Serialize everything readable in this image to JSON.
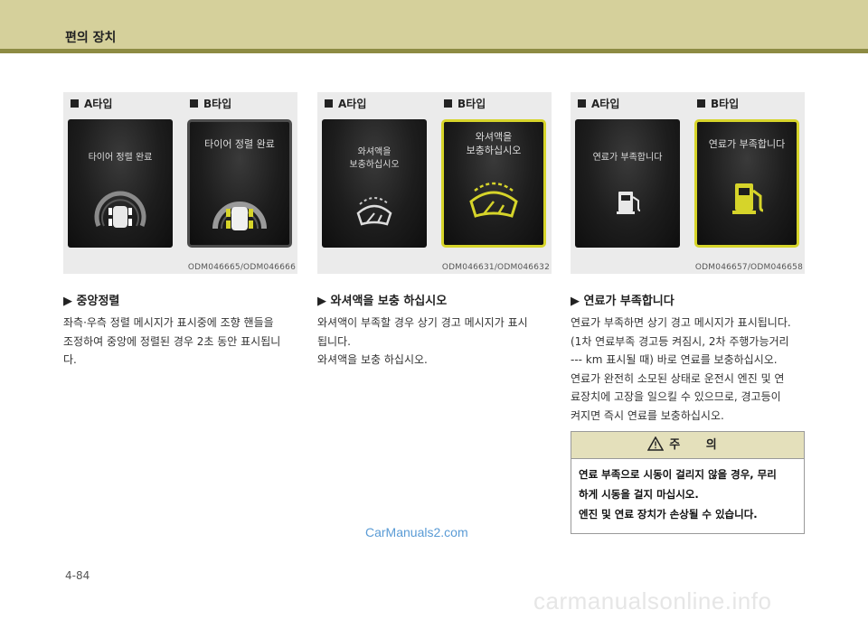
{
  "header": {
    "title": "편의 장치"
  },
  "columns": [
    {
      "panels": [
        {
          "type_label": "A타입",
          "screen_text": [
            "타이어 정렬 완료"
          ]
        },
        {
          "type_label": "B타입",
          "screen_text": [
            "타이어 정렬 완료"
          ]
        }
      ],
      "figure_code": "ODM046665/ODM046666",
      "section_title": "▶ 중앙정렬",
      "body_lines": [
        "좌측·우측 정렬 메시지가 표시중에 조향 핸들을",
        "조정하여 중앙에 정렬된 경우 2초 동안 표시됩니",
        "다."
      ]
    },
    {
      "panels": [
        {
          "type_label": "A타입",
          "screen_text": [
            "와셔액을",
            "보충하십시오"
          ]
        },
        {
          "type_label": "B타입",
          "screen_text": [
            "와셔액을",
            "보충하십시오"
          ]
        }
      ],
      "figure_code": "ODM046631/ODM046632",
      "section_title": "▶ 와셔액을 보충 하십시오",
      "body_lines": [
        "와셔액이 부족할 경우 상기 경고 메시지가 표시",
        "됩니다.",
        "와셔액을 보충 하십시오."
      ]
    },
    {
      "panels": [
        {
          "type_label": "A타입",
          "screen_text": [
            "연료가 부족합니다"
          ]
        },
        {
          "type_label": "B타입",
          "screen_text": [
            "연료가 부족합니다"
          ]
        }
      ],
      "figure_code": "ODM046657/ODM046658",
      "section_title": "▶ 연료가 부족합니다",
      "body_lines": [
        "연료가 부족하면 상기 경고 메시지가 표시됩니다.",
        "(1차 연료부족 경고등 켜짐시, 2차 주행가능거리",
        "--- km 표시될 때) 바로 연료를 보충하십시오.",
        "연료가 완전히 소모된 상태로 운전시 엔진 및 연",
        "료장치에 고장을 일으킬 수 있으므로, 경고등이",
        "켜지면 즉시 연료를 보충하십시오."
      ]
    }
  ],
  "caution": {
    "title": "주 의",
    "lines": [
      "연료 부족으로 시동이  걸리지 않을 경우, 무리",
      "하게 시동을 걸지 마십시오.",
      "엔진 및 연료 장치가 손상될 수 있습니다."
    ]
  },
  "watermark": "CarManuals2.com",
  "page_number": "4-84",
  "footer_mark": "carmanualsonline.info",
  "colors": {
    "header_band": "#d5d09b",
    "header_rule": "#8d8b43",
    "warning_yellow": "#d6d42a",
    "caution_head": "#e4e0bb"
  }
}
